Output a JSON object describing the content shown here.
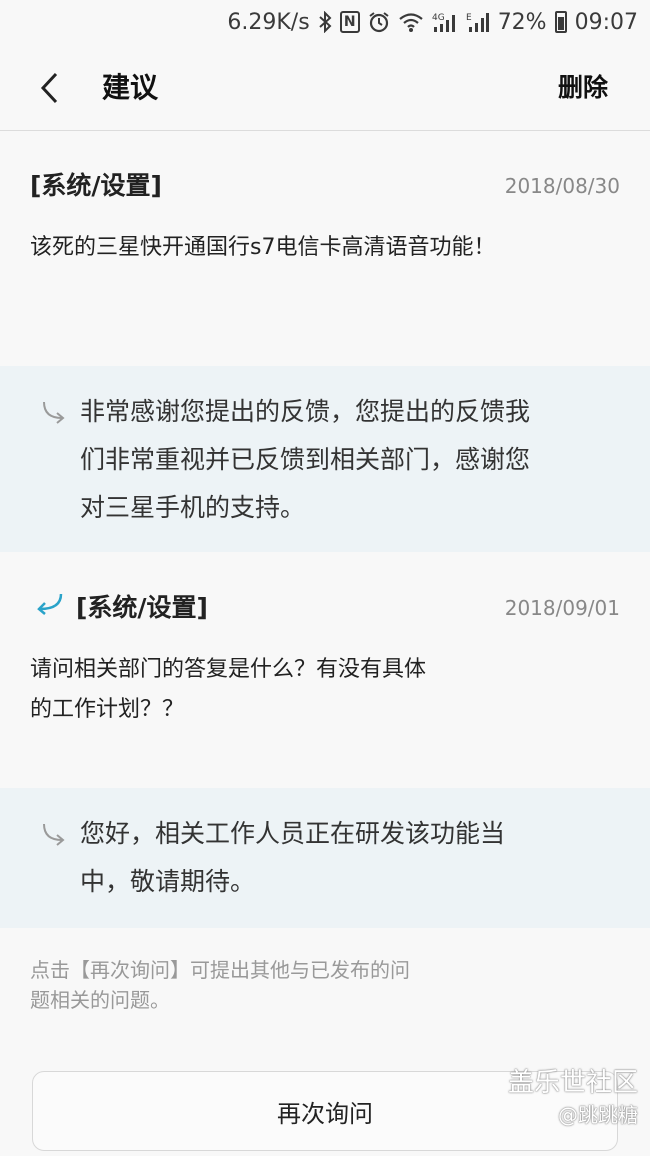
{
  "status_bar": {
    "network_speed": "6.29K/s",
    "battery_percent": "72%",
    "time": "09:07",
    "icons": [
      "bluetooth-icon",
      "nfc-icon",
      "alarm-icon",
      "wifi-icon",
      "signal-4g-icon",
      "signal-e-icon",
      "battery-icon"
    ]
  },
  "header": {
    "title": "建议",
    "delete_label": "删除"
  },
  "threads": [
    {
      "category": "[系统/设置]",
      "date": "2018/08/30",
      "question": "该死的三星快开通国行s7电信卡高清语音功能！",
      "reply_lines": [
        "非常感谢您提出的反馈，您提出的反馈我",
        "们非常重视并已反馈到相关部门，感谢您",
        "对三星手机的支持。"
      ]
    },
    {
      "category": "[系统/设置]",
      "date": "2018/09/01",
      "question_lines": [
        "请问相关部门的答复是什么？有没有具体",
        "的工作计划？？"
      ],
      "reply_lines": [
        "您好，相关工作人员正在研发该功能当",
        "中，敬请期待。"
      ]
    }
  ],
  "hint_lines": [
    "点击【再次询问】可提出其他与已发布的问",
    "题相关的问题。"
  ],
  "ask_again_label": "再次询问",
  "watermark": {
    "line1": "盖乐世社区",
    "line2": "@跳跳糖"
  },
  "colors": {
    "reply_background": "#edf3f6",
    "followup_arrow": "#2aa3c9"
  }
}
